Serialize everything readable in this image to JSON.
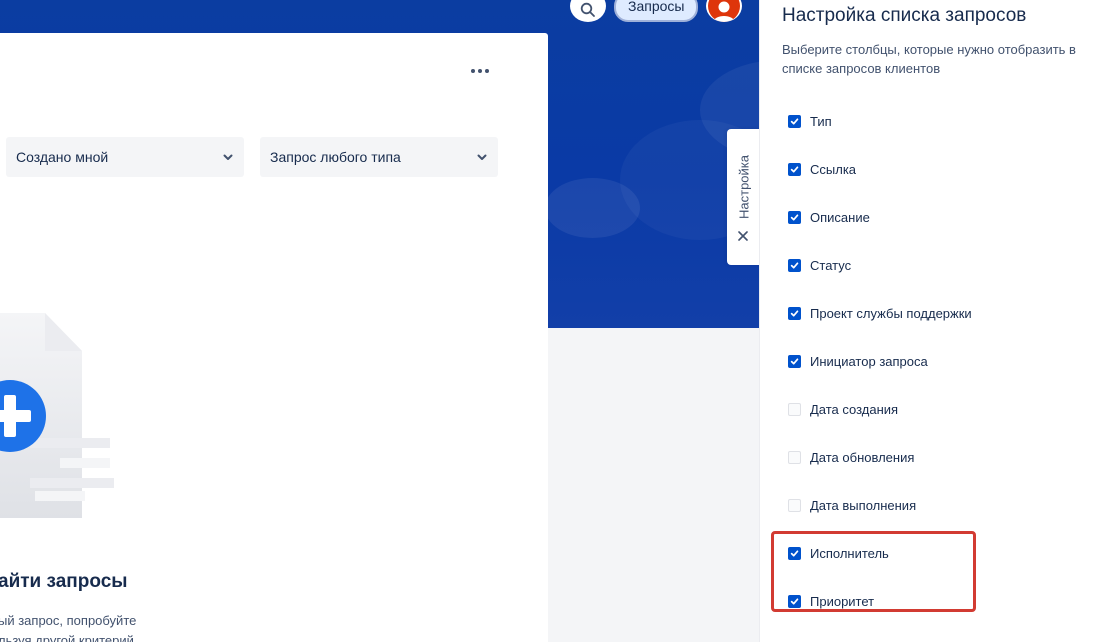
{
  "header": {
    "requests_button": "Запросы",
    "search_icon": "search-icon",
    "avatar_icon": "user-avatar-icon"
  },
  "main": {
    "filters": [
      {
        "label": "Создано мной"
      },
      {
        "label": "Запрос любого типа"
      }
    ],
    "empty_state": {
      "title": "айти запросы",
      "line1": "ый запрос, попробуйте",
      "line2": "льзуя другой критерий"
    }
  },
  "side_tab": {
    "label": "Настройка",
    "close_icon": "close-icon"
  },
  "settings_panel": {
    "title": "Настройка списка запросов",
    "description": "Выберите столбцы, которые нужно отобразить в списке запросов клиентов",
    "options": [
      {
        "label": "Тип",
        "checked": true
      },
      {
        "label": "Ссылка",
        "checked": true
      },
      {
        "label": "Описание",
        "checked": true
      },
      {
        "label": "Статус",
        "checked": true
      },
      {
        "label": "Проект службы поддержки",
        "checked": true
      },
      {
        "label": "Инициатор запроса",
        "checked": true
      },
      {
        "label": "Дата создания",
        "checked": false
      },
      {
        "label": "Дата обновления",
        "checked": false
      },
      {
        "label": "Дата выполнения",
        "checked": false
      },
      {
        "label": "Исполнитель",
        "checked": true
      },
      {
        "label": "Приоритет",
        "checked": true
      }
    ]
  },
  "colors": {
    "hero_blue": "#0b3da1",
    "checkbox_blue": "#0052cc",
    "highlight_red": "#d23b32",
    "plus_blue": "#1e72e8"
  }
}
